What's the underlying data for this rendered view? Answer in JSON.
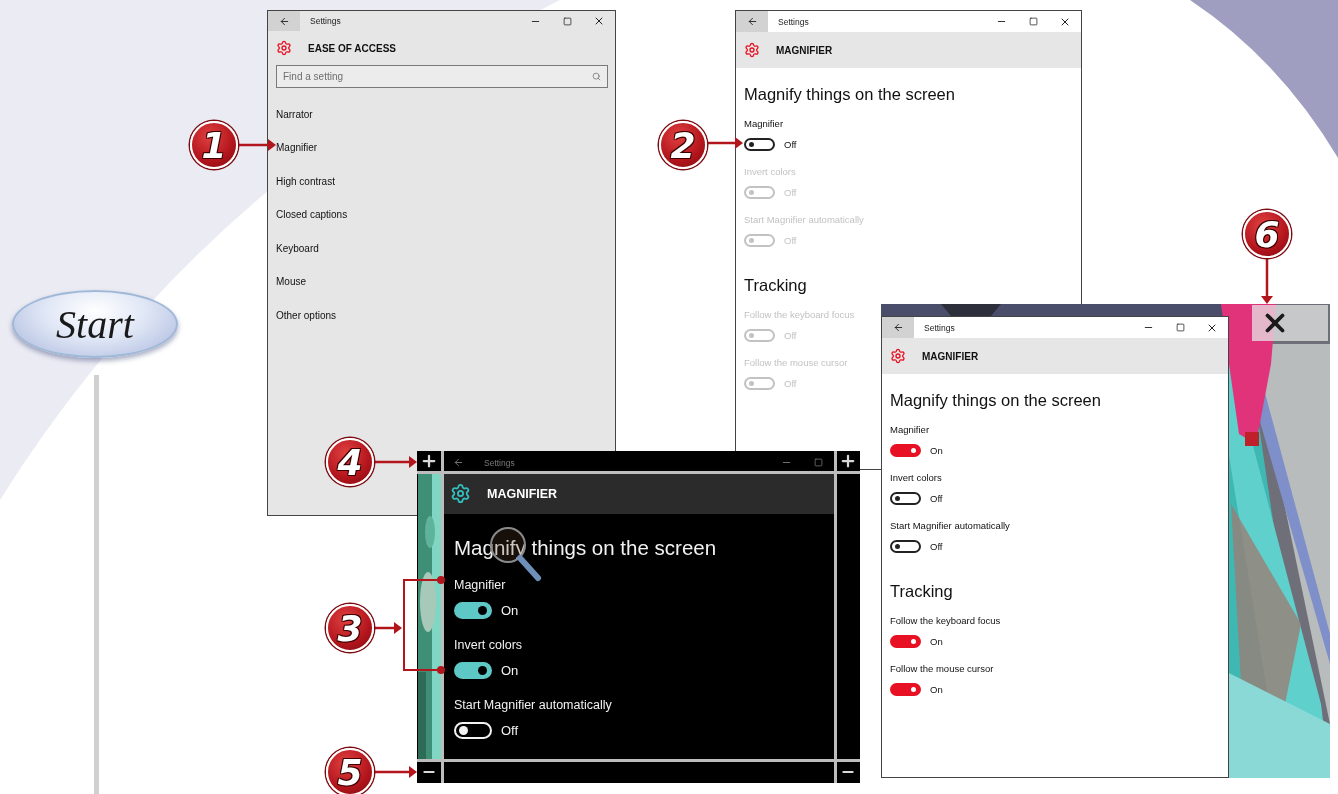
{
  "start_badge": "Start",
  "ease_window": {
    "title": "Settings",
    "header": "EASE OF ACCESS",
    "search": {
      "placeholder": "Find a setting"
    },
    "items": [
      "Narrator",
      "Magnifier",
      "High contrast",
      "Closed captions",
      "Keyboard",
      "Mouse",
      "Other options"
    ]
  },
  "magnifier_windows": [
    {
      "kind": "light",
      "title": "Settings",
      "header": "MAGNIFIER",
      "heading": "Magnify things on the screen",
      "options": [
        {
          "label": "Magnifier",
          "state": "Off",
          "on": false,
          "disabled": false
        },
        {
          "label": "Invert colors",
          "state": "Off",
          "on": false,
          "disabled": true
        },
        {
          "label": "Start Magnifier automatically",
          "state": "Off",
          "on": false,
          "disabled": true
        }
      ],
      "section": "Tracking",
      "tracking": [
        {
          "label": "Follow the keyboard focus",
          "state": "Off",
          "on": false,
          "disabled": true
        },
        {
          "label": "Follow the mouse cursor",
          "state": "Off",
          "on": false,
          "disabled": true
        }
      ]
    },
    {
      "kind": "lens",
      "title": "Settings",
      "header": "MAGNIFIER",
      "heading": "Magnify things on the screen",
      "options": [
        {
          "label": "Magnifier",
          "state": "On",
          "on": true,
          "disabled": false
        },
        {
          "label": "Invert colors",
          "state": "On",
          "on": true,
          "disabled": false
        },
        {
          "label": "Start Magnifier automatically",
          "state": "Off",
          "on": false,
          "disabled": false
        }
      ]
    },
    {
      "kind": "light",
      "title": "Settings",
      "header": "MAGNIFIER",
      "heading": "Magnify things on the screen",
      "options": [
        {
          "label": "Magnifier",
          "state": "On",
          "on": true,
          "disabled": false
        },
        {
          "label": "Invert colors",
          "state": "Off",
          "on": false,
          "disabled": false
        },
        {
          "label": "Start Magnifier automatically",
          "state": "Off",
          "on": false,
          "disabled": false
        }
      ],
      "section": "Tracking",
      "tracking": [
        {
          "label": "Follow the keyboard focus",
          "state": "On",
          "on": true,
          "disabled": false
        },
        {
          "label": "Follow the mouse cursor",
          "state": "On",
          "on": true,
          "disabled": false
        }
      ]
    }
  ],
  "callouts": [
    "1",
    "2",
    "6",
    "4",
    "3",
    "5"
  ]
}
